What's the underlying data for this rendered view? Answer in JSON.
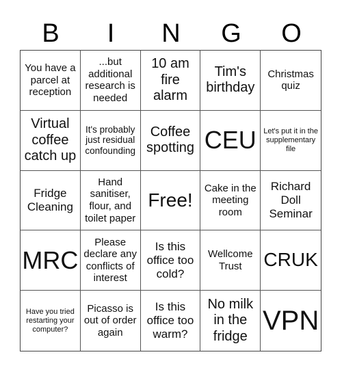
{
  "header": {
    "letters": [
      "B",
      "I",
      "N",
      "G",
      "O"
    ]
  },
  "cells": [
    "You have a parcel at reception",
    "...but additional research is needed",
    "10 am fire alarm",
    "Tim's birthday",
    "Christmas quiz",
    "Virtual coffee catch up",
    "It's probably just residual confounding",
    "Coffee spotting",
    "CEU",
    "Let's put it in the supplementary file",
    "Fridge Cleaning",
    "Hand sanitiser, flour, and toilet paper",
    "Free!",
    "Cake in the meeting room",
    "Richard Doll Seminar",
    "MRC",
    "Please declare any conflicts of interest",
    "Is this office too cold?",
    "Wellcome Trust",
    "CRUK",
    "Have you tried restarting your computer?",
    "Picasso is out of order again",
    "Is this office too warm?",
    "No milk in the fridge",
    "VPN"
  ]
}
